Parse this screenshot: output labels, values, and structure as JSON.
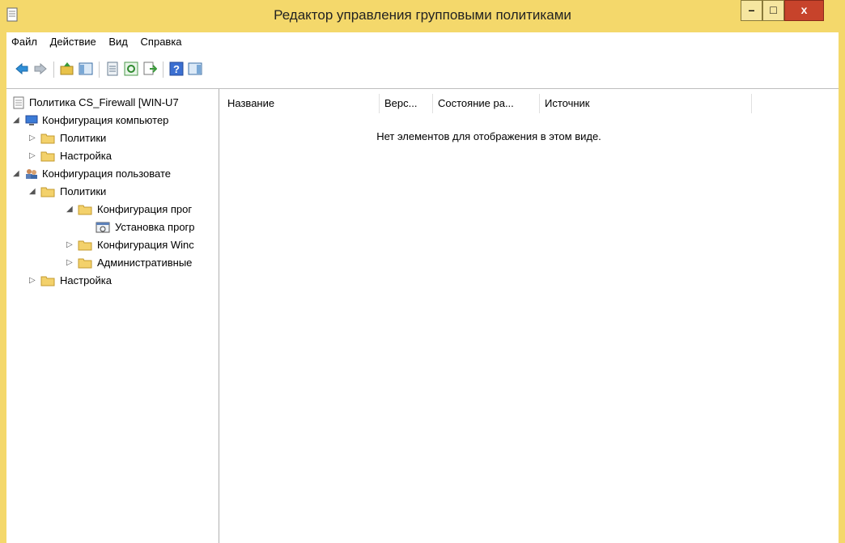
{
  "window": {
    "title": "Редактор управления групповыми политиками",
    "controls": {
      "minimize": "–",
      "maximize": "□",
      "close": "x"
    },
    "colors": {
      "frame": "#f4d86b",
      "close": "#c7432b"
    }
  },
  "menu": [
    "Файл",
    "Действие",
    "Вид",
    "Справка"
  ],
  "toolbar": [
    "back-icon",
    "forward-icon",
    "up-folder-icon",
    "show-tree-icon",
    "properties-icon",
    "refresh-icon",
    "export-icon",
    "help-icon",
    "show-action-pane-icon"
  ],
  "tree": {
    "root": "Политика CS_Firewall [WIN-U7",
    "computer": {
      "label": "Конфигурация компьютер",
      "policies": "Политики",
      "preferences": "Настройка"
    },
    "user": {
      "label": "Конфигурация пользовате",
      "policies": "Политики",
      "software": "Конфигурация прог",
      "install": "Установка прогр",
      "windows": "Конфигурация Winc",
      "admin": "Административные",
      "preferences": "Настройка"
    }
  },
  "list": {
    "columns": [
      "Название",
      "Верс...",
      "Состояние ра...",
      "Источник"
    ],
    "empty_message": "Нет элементов для отображения в этом виде."
  }
}
